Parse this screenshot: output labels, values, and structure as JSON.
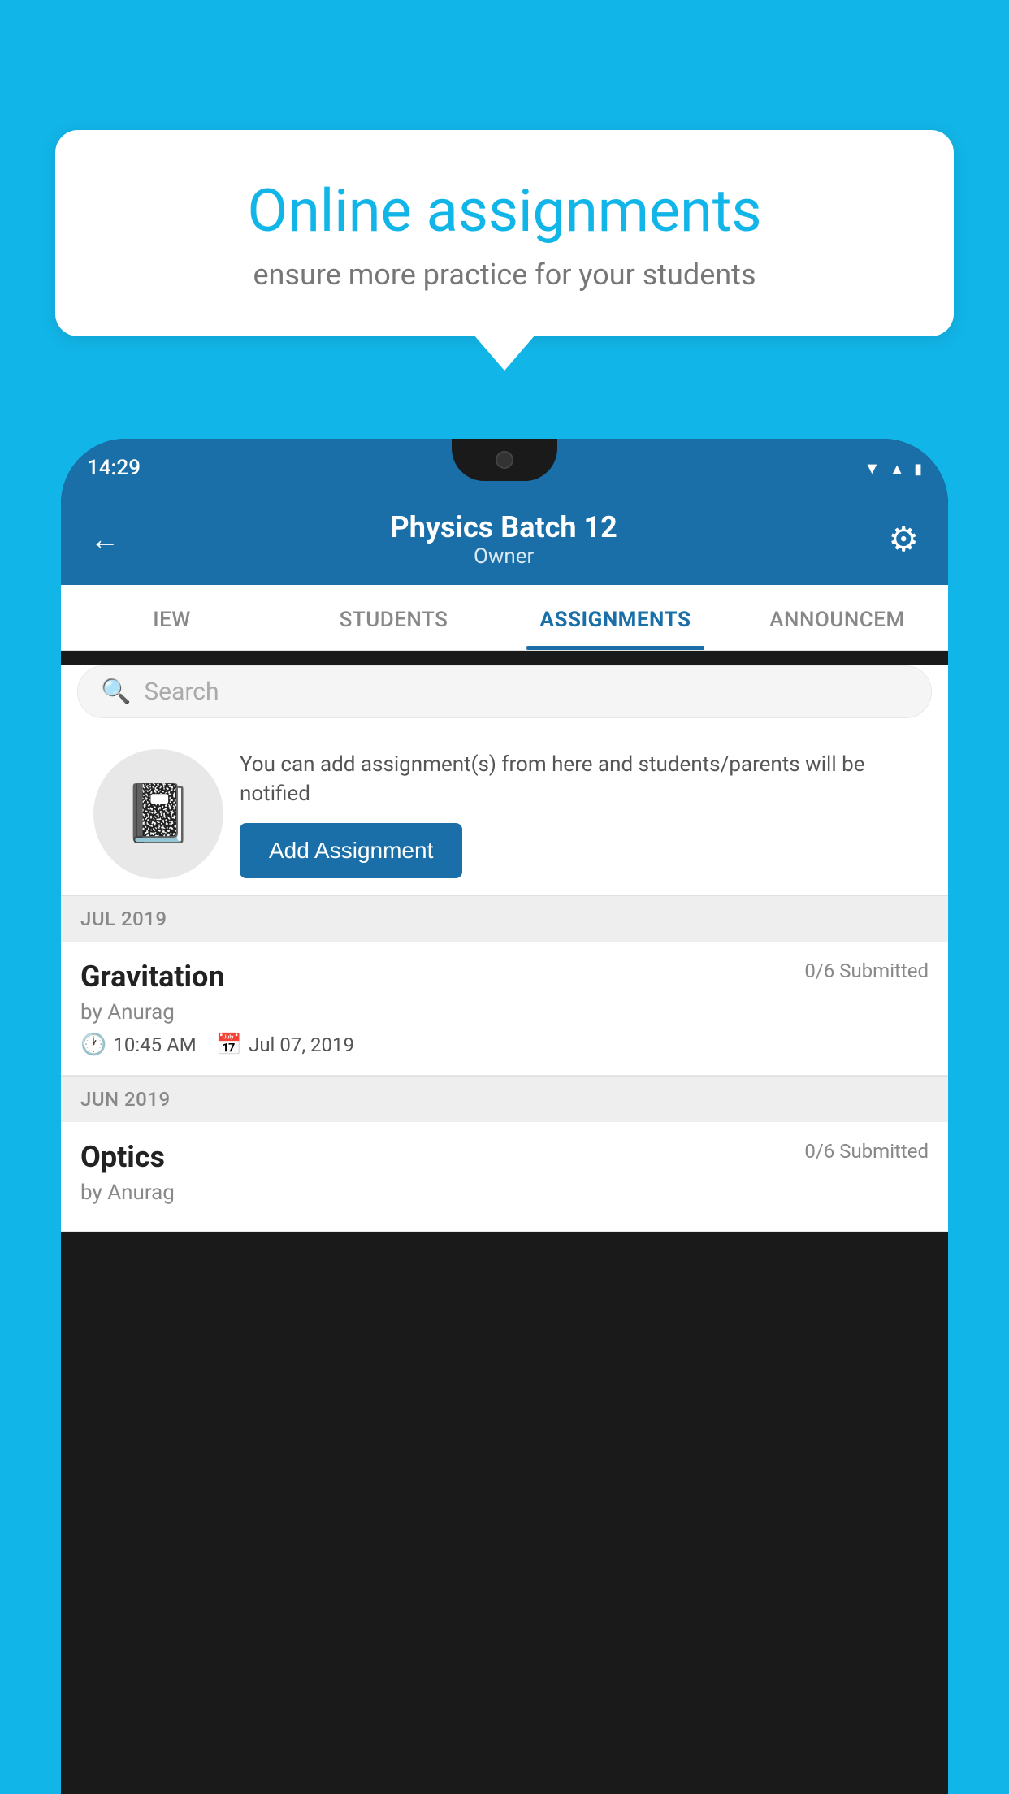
{
  "background_color": "#12B5E8",
  "speech_bubble": {
    "title": "Online assignments",
    "subtitle": "ensure more practice for your students"
  },
  "phone": {
    "status_bar": {
      "time": "14:29",
      "wifi": "▼",
      "signal": "◀",
      "battery": "▮"
    },
    "header": {
      "title": "Physics Batch 12",
      "subtitle": "Owner",
      "back_label": "←",
      "gear_label": "⚙"
    },
    "tabs": [
      {
        "label": "IEW",
        "active": false
      },
      {
        "label": "STUDENTS",
        "active": false
      },
      {
        "label": "ASSIGNMENTS",
        "active": true
      },
      {
        "label": "ANNOUNCEM",
        "active": false
      }
    ],
    "search": {
      "placeholder": "Search"
    },
    "promo": {
      "description": "You can add assignment(s) from here and students/parents will be notified",
      "button_label": "Add Assignment"
    },
    "sections": [
      {
        "header": "JUL 2019",
        "assignments": [
          {
            "name": "Gravitation",
            "submitted": "0/6 Submitted",
            "by": "by Anurag",
            "time": "10:45 AM",
            "date": "Jul 07, 2019"
          }
        ]
      },
      {
        "header": "JUN 2019",
        "assignments": [
          {
            "name": "Optics",
            "submitted": "0/6 Submitted",
            "by": "by Anurag",
            "time": "",
            "date": ""
          }
        ]
      }
    ]
  }
}
